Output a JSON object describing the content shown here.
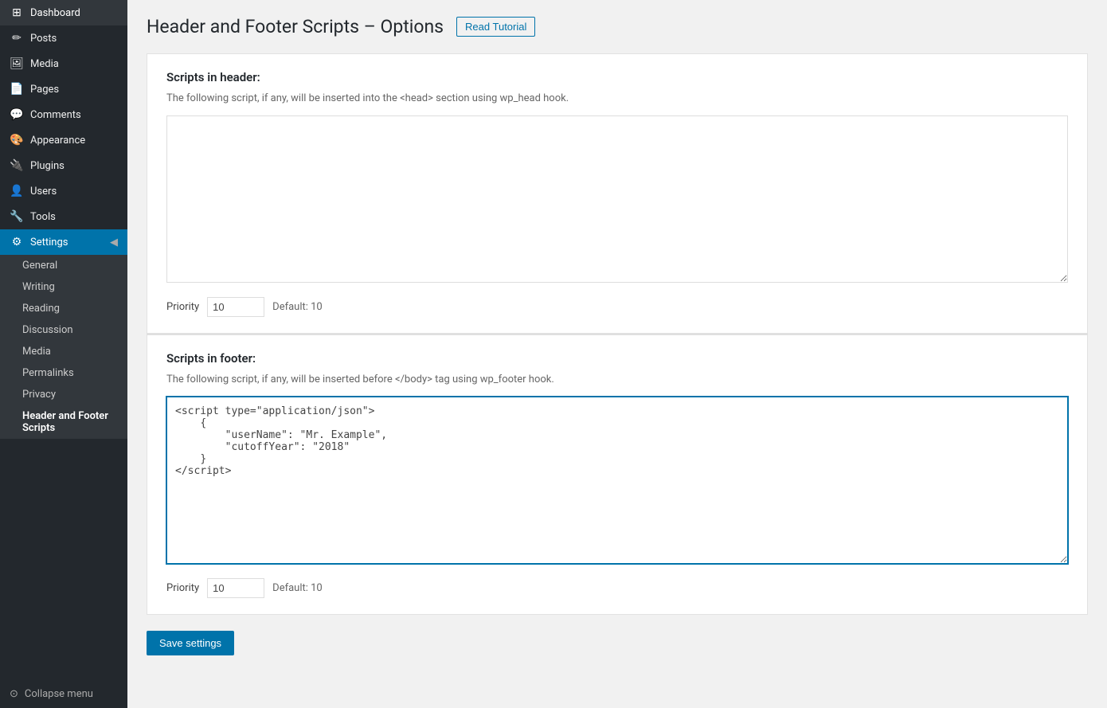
{
  "sidebar": {
    "items": [
      {
        "id": "dashboard",
        "label": "Dashboard",
        "icon": "⊞"
      },
      {
        "id": "posts",
        "label": "Posts",
        "icon": "✏"
      },
      {
        "id": "media",
        "label": "Media",
        "icon": "🖼"
      },
      {
        "id": "pages",
        "label": "Pages",
        "icon": "📄"
      },
      {
        "id": "comments",
        "label": "Comments",
        "icon": "💬"
      },
      {
        "id": "appearance",
        "label": "Appearance",
        "icon": "🎨"
      },
      {
        "id": "plugins",
        "label": "Plugins",
        "icon": "🔌"
      },
      {
        "id": "users",
        "label": "Users",
        "icon": "👤"
      },
      {
        "id": "tools",
        "label": "Tools",
        "icon": "🔧"
      },
      {
        "id": "settings",
        "label": "Settings",
        "icon": "⚙",
        "active": true
      }
    ],
    "submenu": [
      {
        "id": "general",
        "label": "General"
      },
      {
        "id": "writing",
        "label": "Writing"
      },
      {
        "id": "reading",
        "label": "Reading"
      },
      {
        "id": "discussion",
        "label": "Discussion"
      },
      {
        "id": "media",
        "label": "Media"
      },
      {
        "id": "permalinks",
        "label": "Permalinks"
      },
      {
        "id": "privacy",
        "label": "Privacy"
      },
      {
        "id": "header-footer-scripts",
        "label": "Header and Footer Scripts",
        "active": true
      }
    ],
    "collapse_label": "Collapse menu"
  },
  "page": {
    "title": "Header and Footer Scripts – Options",
    "read_tutorial_label": "Read Tutorial"
  },
  "scripts_in_header": {
    "title": "Scripts in header:",
    "description": "The following script, if any, will be inserted into the <head> section using wp_head hook.",
    "value": "",
    "priority_label": "Priority",
    "priority_value": "10",
    "priority_default": "Default: 10"
  },
  "scripts_in_footer": {
    "title": "Scripts in footer:",
    "description": "The following script, if any, will be inserted before </body> tag using wp_footer hook.",
    "value": "<script type=\"application/json\">\n    {\n        \"userName\": \"Mr. Example\",\n        \"cutoffYear\": \"2018\"\n    }\n</script>",
    "priority_label": "Priority",
    "priority_value": "10",
    "priority_default": "Default: 10"
  },
  "save_button_label": "Save settings"
}
